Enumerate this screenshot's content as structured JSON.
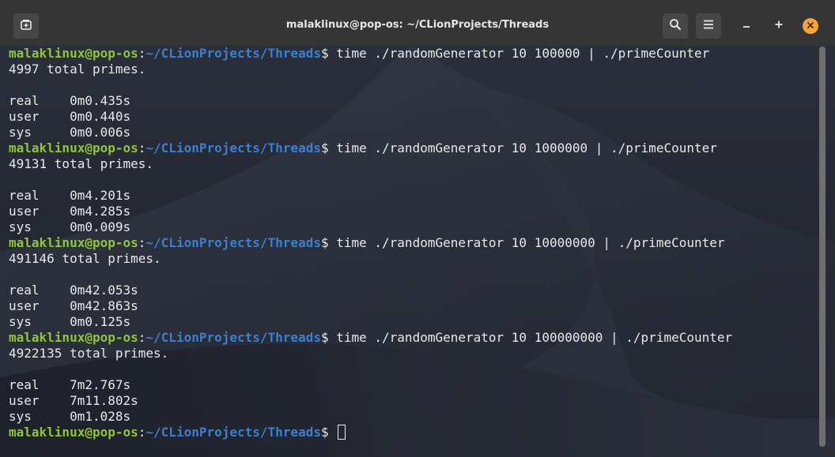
{
  "window": {
    "title": "malaklinux@pop-os: ~/CLionProjects/Threads"
  },
  "titlebar_buttons": {
    "new_tab_icon": "new-tab-icon",
    "search_icon": "search-icon",
    "menu_icon": "hamburger-menu-icon",
    "minimize_icon": "minimize-icon",
    "maximize_icon": "maximize-icon",
    "close_icon": "close-icon"
  },
  "colors": {
    "prompt_user": "#8ec43e",
    "prompt_path": "#3c7fd0",
    "close_button": "#f6a33c"
  },
  "prompt": {
    "user_host": "malaklinux@pop-os",
    "colon": ":",
    "path": "~/CLionProjects/Threads",
    "symbol": "$ "
  },
  "runs": [
    {
      "command": "time ./randomGenerator 10 100000 | ./primeCounter",
      "output": "4997 total primes.",
      "real": "real\t0m0.435s",
      "user": "user\t0m0.440s",
      "sys": "sys\t0m0.006s"
    },
    {
      "command": "time ./randomGenerator 10 1000000 | ./primeCounter",
      "output": "49131 total primes.",
      "real": "real\t0m4.201s",
      "user": "user\t0m4.285s",
      "sys": "sys\t0m0.009s"
    },
    {
      "command": "time ./randomGenerator 10 10000000 | ./primeCounter",
      "output": "491146 total primes.",
      "real": "real\t0m42.053s",
      "user": "user\t0m42.863s",
      "sys": "sys\t0m0.125s"
    },
    {
      "command": "time ./randomGenerator 10 100000000 | ./primeCounter",
      "output": "4922135 total primes.",
      "real": "real\t7m2.767s",
      "user": "user\t7m11.802s",
      "sys": "sys\t0m1.028s"
    }
  ]
}
